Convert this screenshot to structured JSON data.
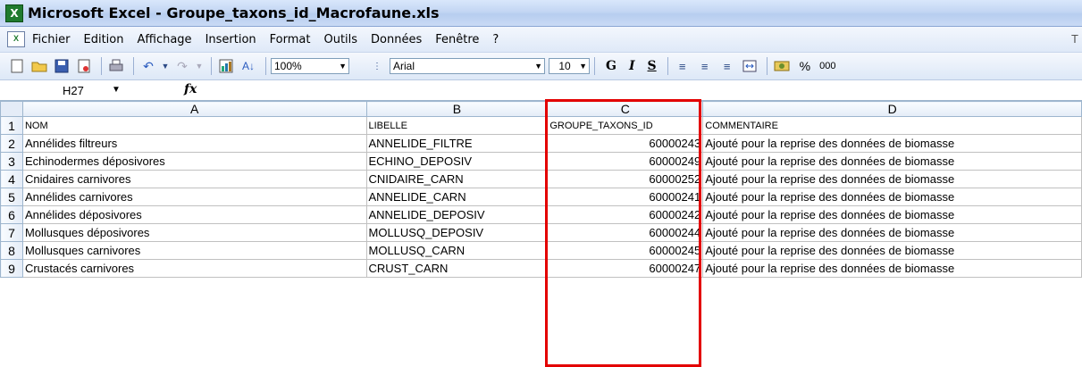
{
  "window": {
    "title": "Microsoft Excel - Groupe_taxons_id_Macrofaune.xls"
  },
  "menu": {
    "items": [
      "Fichier",
      "Edition",
      "Affichage",
      "Insertion",
      "Format",
      "Outils",
      "Données",
      "Fenêtre",
      "?"
    ],
    "right_text": "T"
  },
  "toolbar": {
    "zoom": "100%",
    "font": "Arial",
    "size": "10",
    "bold": "G",
    "italic": "I",
    "underline": "S",
    "percent": "%",
    "thousands": "000"
  },
  "formula": {
    "cell_ref": "H27",
    "fx": "fx"
  },
  "grid": {
    "columns": [
      "A",
      "B",
      "C",
      "D"
    ],
    "headers": [
      "NOM",
      "LIBELLE",
      "GROUPE_TAXONS_ID",
      "COMMENTAIRE"
    ],
    "rows": [
      {
        "n": "2",
        "nom": "Annélides filtreurs",
        "libelle": "ANNELIDE_FILTRE",
        "id": "60000243",
        "comment": "Ajouté pour la reprise des données de biomasse"
      },
      {
        "n": "3",
        "nom": "Echinodermes déposivores",
        "libelle": "ECHINO_DEPOSIV",
        "id": "60000249",
        "comment": "Ajouté pour la reprise des données de biomasse"
      },
      {
        "n": "4",
        "nom": "Cnidaires carnivores",
        "libelle": "CNIDAIRE_CARN",
        "id": "60000252",
        "comment": "Ajouté pour la reprise des données de biomasse"
      },
      {
        "n": "5",
        "nom": "Annélides carnivores",
        "libelle": "ANNELIDE_CARN",
        "id": "60000241",
        "comment": "Ajouté pour la reprise des données de biomasse"
      },
      {
        "n": "6",
        "nom": "Annélides déposivores",
        "libelle": "ANNELIDE_DEPOSIV",
        "id": "60000242",
        "comment": "Ajouté pour la reprise des données de biomasse"
      },
      {
        "n": "7",
        "nom": "Mollusques déposivores",
        "libelle": "MOLLUSQ_DEPOSIV",
        "id": "60000244",
        "comment": "Ajouté pour la reprise des données de biomasse"
      },
      {
        "n": "8",
        "nom": "Mollusques carnivores",
        "libelle": "MOLLUSQ_CARN",
        "id": "60000245",
        "comment": "Ajouté pour la reprise des données de biomasse"
      },
      {
        "n": "9",
        "nom": "Crustacés carnivores",
        "libelle": "CRUST_CARN",
        "id": "60000247",
        "comment": "Ajouté pour la reprise des données de biomasse"
      }
    ]
  }
}
